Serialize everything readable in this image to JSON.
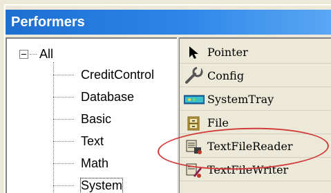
{
  "window": {
    "title": "Performers"
  },
  "tree": {
    "root": "All",
    "children": [
      "CreditControl",
      "Database",
      "Basic",
      "Text",
      "Math",
      "System"
    ],
    "selected": "System"
  },
  "palette": {
    "items": [
      {
        "label": "Pointer",
        "icon": "arrow-pointer-icon"
      },
      {
        "label": "Config",
        "icon": "wrench-icon"
      },
      {
        "label": "SystemTray",
        "icon": "system-tray-icon"
      },
      {
        "label": "File",
        "icon": "file-cabinet-icon"
      },
      {
        "label": "TextFileReader",
        "icon": "text-file-reader-icon"
      },
      {
        "label": "TextFileWriter",
        "icon": "text-file-writer-icon"
      }
    ],
    "highlighted": "TextFileReader"
  },
  "colors": {
    "title_bar": "#2f86e8",
    "highlight_ellipse": "#d23a3a",
    "panel_bg": "#ece9d8"
  }
}
